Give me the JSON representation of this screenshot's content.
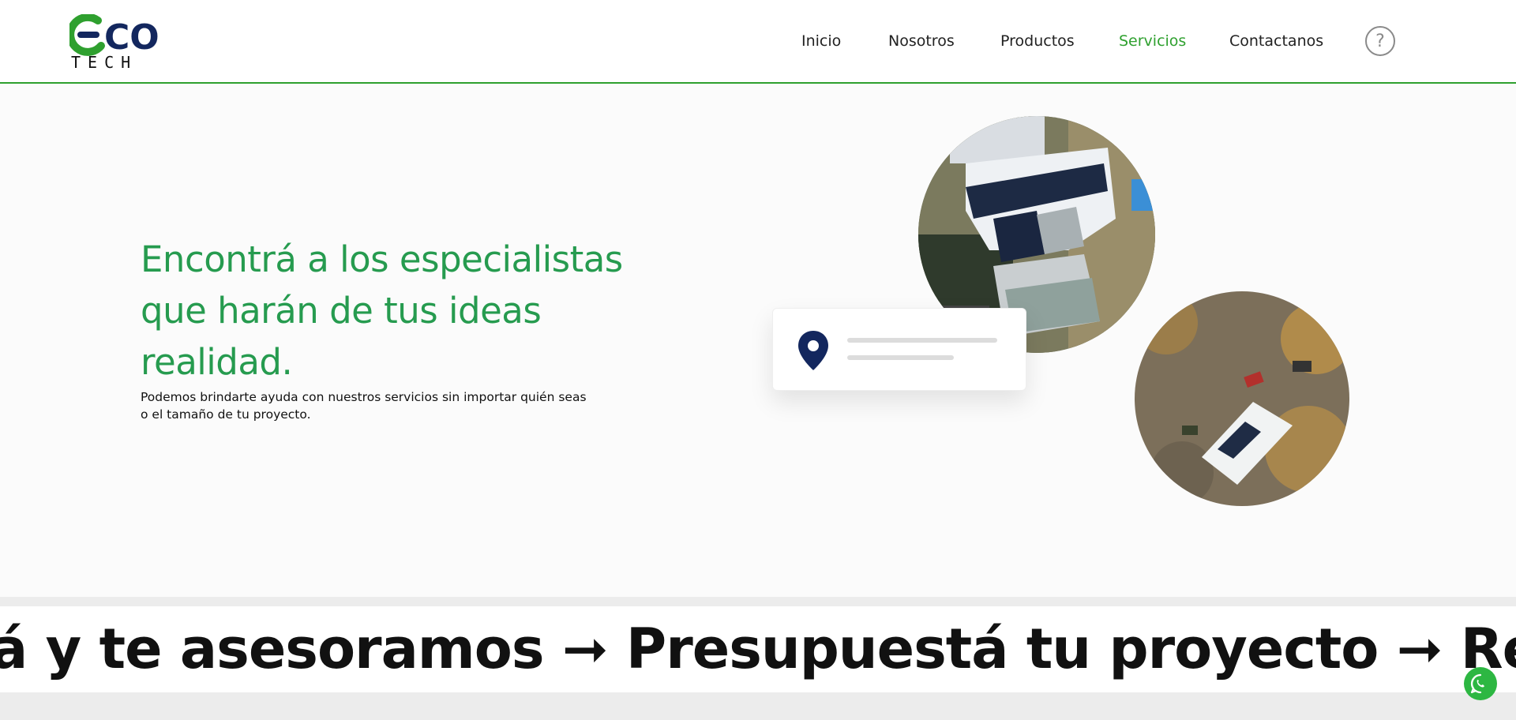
{
  "brand": {
    "logo_top": "CO",
    "logo_bottom": "TECH",
    "colors": {
      "green": "#2fa02f",
      "navy": "#13275e",
      "title_green": "#269b4f"
    }
  },
  "nav": {
    "items": [
      {
        "label": "Inicio"
      },
      {
        "label": "Nosotros"
      },
      {
        "label": "Productos"
      },
      {
        "label": "Servicios",
        "active": true
      },
      {
        "label": "Contactanos"
      }
    ],
    "help_icon": "?"
  },
  "hero": {
    "title": "Encontrá a los especialistas que harán de tus ideas realidad.",
    "subtitle": "Podemos brindarte ayuda con nuestros servicios sin importar quién seas o el tamaño de tu proyecto."
  },
  "illustration": {
    "icon": "location-pin-icon"
  },
  "marquee": {
    "text": "á y te asesoramos ➞ Presupuestá tu proyecto ➞ Reunite con"
  },
  "floating": {
    "icon": "whatsapp-icon"
  }
}
